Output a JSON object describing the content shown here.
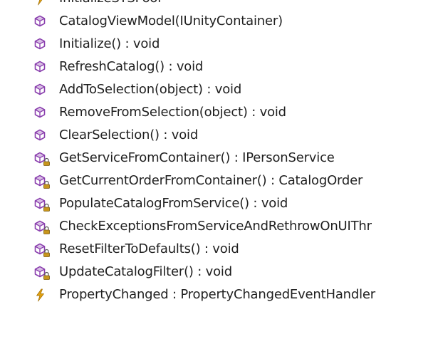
{
  "members": [
    {
      "label": "InitializeSYSPool",
      "icon": "event-icon",
      "visibility": "public"
    },
    {
      "label": "CatalogViewModel(IUnityContainer)",
      "icon": "method-icon",
      "visibility": "public"
    },
    {
      "label": "Initialize() : void",
      "icon": "method-icon",
      "visibility": "public"
    },
    {
      "label": "RefreshCatalog() : void",
      "icon": "method-icon",
      "visibility": "public"
    },
    {
      "label": "AddToSelection(object) : void",
      "icon": "method-icon",
      "visibility": "public"
    },
    {
      "label": "RemoveFromSelection(object) : void",
      "icon": "method-icon",
      "visibility": "public"
    },
    {
      "label": "ClearSelection() : void",
      "icon": "method-icon",
      "visibility": "public"
    },
    {
      "label": "GetServiceFromContainer() : IPersonService",
      "icon": "private-method-icon",
      "visibility": "private"
    },
    {
      "label": "GetCurrentOrderFromContainer() : CatalogOrder",
      "icon": "private-method-icon",
      "visibility": "private"
    },
    {
      "label": "PopulateCatalogFromService() : void",
      "icon": "private-method-icon",
      "visibility": "private"
    },
    {
      "label": "CheckExceptionsFromServiceAndRethrowOnUIThr",
      "icon": "private-method-icon",
      "visibility": "private"
    },
    {
      "label": "ResetFilterToDefaults() : void",
      "icon": "private-method-icon",
      "visibility": "private"
    },
    {
      "label": "UpdateCatalogFilter() : void",
      "icon": "private-method-icon",
      "visibility": "private"
    },
    {
      "label": "PropertyChanged : PropertyChangedEventHandler",
      "icon": "event-icon",
      "visibility": "public"
    }
  ],
  "colors": {
    "method": "#8a3fae",
    "lock": "#c8961c",
    "event": "#e0a010",
    "text": "#1f1f1f"
  }
}
